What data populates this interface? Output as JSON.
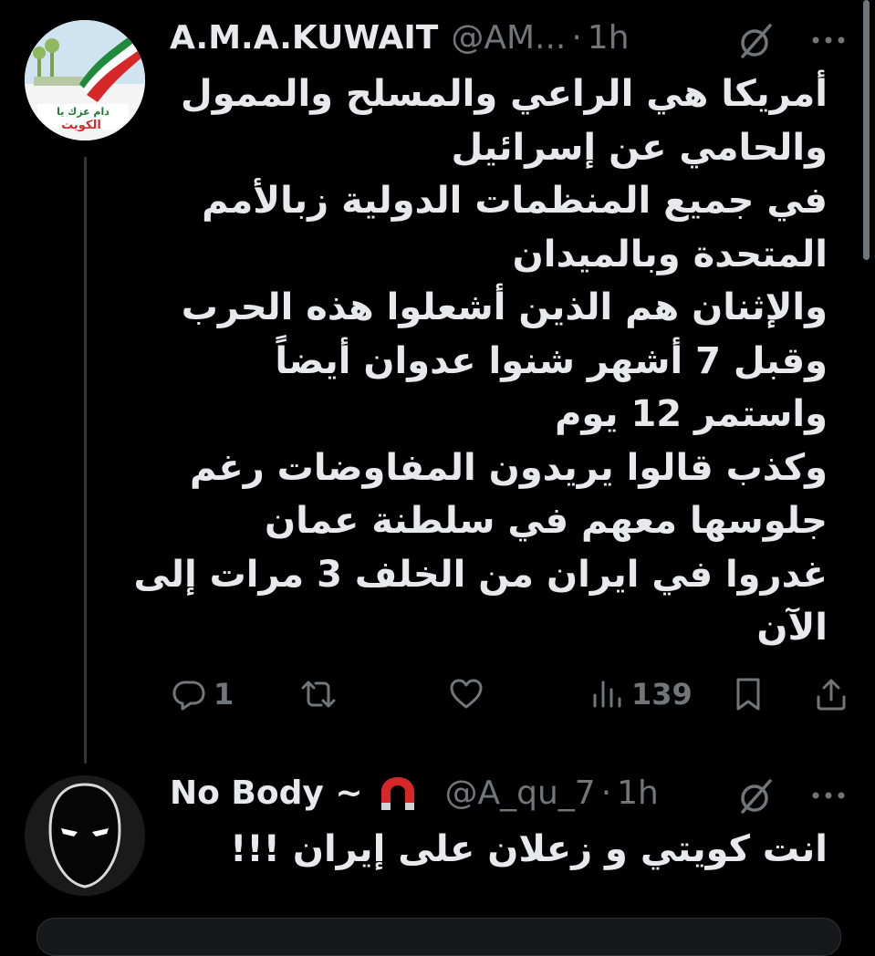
{
  "tweet1": {
    "name": "A.M.A.KUWAIT",
    "handle": "@AM...",
    "separator": "·",
    "time": "1h",
    "avatar_text_line1": "دام عزك يا",
    "avatar_text_line2": "الكويت",
    "lines": [
      "أمريكا هي الراعي والمسلح والممول",
      "والحامي عن إسرائيل",
      "في جميع المنظمات الدولية زبالأمم",
      "المتحدة وبالميدان",
      "والإثنان هم الذين أشعلوا هذه الحرب",
      "وقبل 7 أشهر شنوا عدوان أيضاً",
      "واستمر 12 يوم",
      "وكذب قالوا يريدون المفاوضات  رغم",
      "جلوسها معهم في سلطنة عمان",
      "غدروا في ايران من الخلف 3 مرات إلى",
      "الآن"
    ],
    "actions": {
      "replies": "1",
      "views": "139"
    }
  },
  "tweet2": {
    "name": "No Body ~",
    "handle": "@A_qu_7",
    "separator": "·",
    "time": "1h",
    "text": "انت كويتي و زعلان على إيران !!!"
  },
  "icons": {
    "grok": "grok-icon",
    "more": "more-icon",
    "reply": "reply-icon",
    "retweet": "retweet-icon",
    "like": "heart-icon",
    "views": "views-icon",
    "bookmark": "bookmark-icon",
    "share": "share-icon",
    "magnet": "magnet-emoji-icon"
  },
  "colors": {
    "background": "#000000",
    "text": "#e7e9ea",
    "muted": "#71767b",
    "magnet_red": "#d62828"
  }
}
